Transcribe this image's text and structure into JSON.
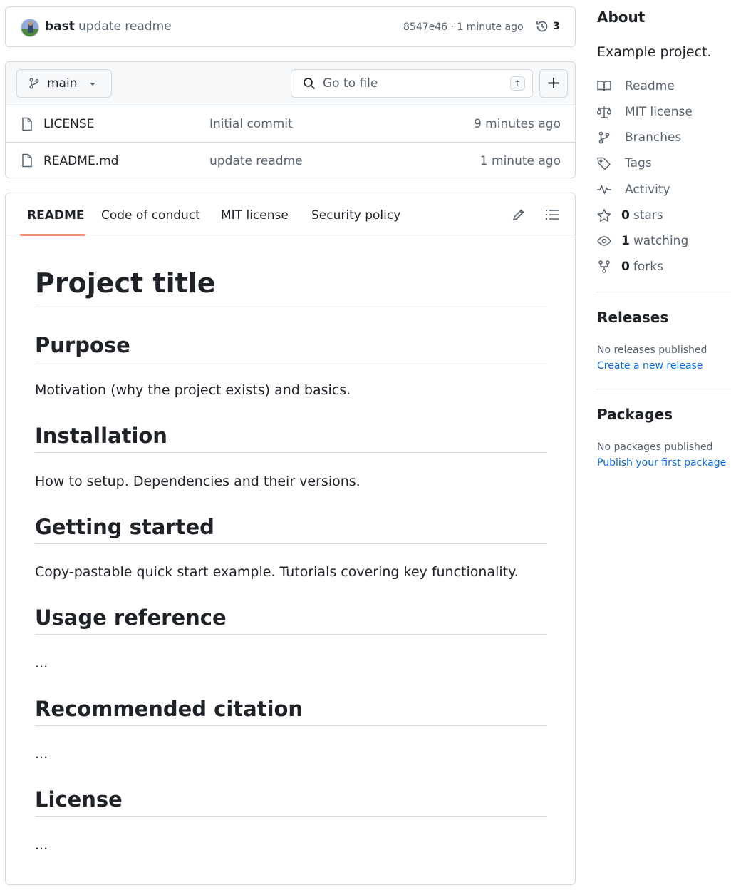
{
  "commit": {
    "author": "bast",
    "message": "update readme",
    "meta": "8547e46 · 1 minute ago",
    "history_count": "3"
  },
  "file_browser": {
    "branch": "main",
    "goto_placeholder": "Go to file",
    "goto_shortcut": "t",
    "add_label": "+",
    "files": [
      {
        "name": "LICENSE",
        "message": "Initial commit",
        "time": "9 minutes ago"
      },
      {
        "name": "README.md",
        "message": "update readme",
        "time": "1 minute ago"
      }
    ]
  },
  "readme": {
    "tabs": [
      "README",
      "Code of conduct",
      "MIT license",
      "Security policy"
    ],
    "active_tab": "README",
    "title": "Project title",
    "sections": [
      {
        "heading": "Purpose",
        "text": "Motivation (why the project exists) and basics."
      },
      {
        "heading": "Installation",
        "text": "How to setup. Dependencies and their versions."
      },
      {
        "heading": "Getting started",
        "text": "Copy-pastable quick start example. Tutorials covering key functionality."
      },
      {
        "heading": "Usage reference",
        "text": "..."
      },
      {
        "heading": "Recommended citation",
        "text": "..."
      },
      {
        "heading": "License",
        "text": "..."
      }
    ]
  },
  "sidebar": {
    "about_heading": "About",
    "description": "Example project.",
    "links": [
      {
        "icon": "book-icon",
        "count": "",
        "label": "Readme"
      },
      {
        "icon": "law-icon",
        "count": "",
        "label": "MIT license"
      },
      {
        "icon": "branch-icon",
        "count": "",
        "label": "Branches"
      },
      {
        "icon": "tag-icon",
        "count": "",
        "label": "Tags"
      },
      {
        "icon": "pulse-icon",
        "count": "",
        "label": "Activity"
      },
      {
        "icon": "star-icon",
        "count": "0",
        "label": "stars"
      },
      {
        "icon": "eye-icon",
        "count": "1",
        "label": "watching"
      },
      {
        "icon": "fork-icon",
        "count": "0",
        "label": "forks"
      }
    ],
    "releases_heading": "Releases",
    "releases_empty": "No releases published",
    "releases_link": "Create a new release",
    "packages_heading": "Packages",
    "packages_empty": "No packages published",
    "packages_link": "Publish your first package"
  },
  "colors": {
    "border": "#d1d9e0",
    "muted": "#59636e",
    "link": "#0969da",
    "tab_underline": "#fd8c73"
  }
}
